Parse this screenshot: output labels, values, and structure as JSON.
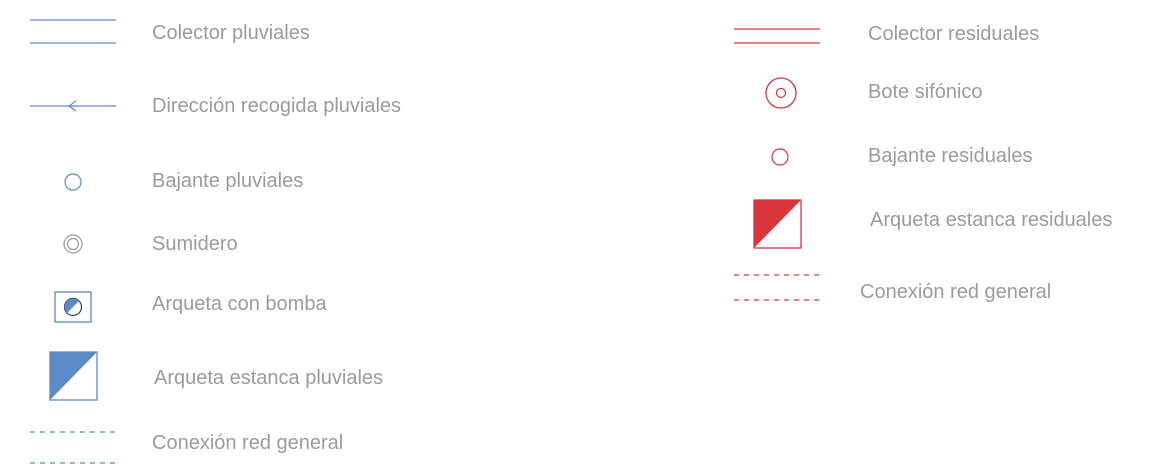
{
  "colors": {
    "pluviales": "#5b8ac6",
    "residuales": "#d8363c",
    "label_text": "#9b9b9b"
  },
  "legend": {
    "pluviales": [
      {
        "icon": "double-line-icon",
        "label": "Colector pluviales"
      },
      {
        "icon": "arrow-left-line-icon",
        "label": "Dirección recogida pluviales"
      },
      {
        "icon": "circle-icon",
        "label": "Bajante pluviales"
      },
      {
        "icon": "double-circle-icon",
        "label": "Sumidero"
      },
      {
        "icon": "pump-box-icon",
        "label": "Arqueta con bomba"
      },
      {
        "icon": "half-filled-square-icon",
        "label": "Arqueta estanca pluviales"
      },
      {
        "icon": "dashed-double-line-icon",
        "label": "Conexión red general"
      }
    ],
    "residuales": [
      {
        "icon": "double-line-icon",
        "label": "Colector residuales"
      },
      {
        "icon": "circle-with-dot-icon",
        "label": "Bote sifónico"
      },
      {
        "icon": "circle-icon",
        "label": "Bajante residuales"
      },
      {
        "icon": "half-filled-square-icon",
        "label": "Arqueta estanca residuales"
      },
      {
        "icon": "dashed-double-line-icon",
        "label": "Conexión red general"
      }
    ]
  }
}
